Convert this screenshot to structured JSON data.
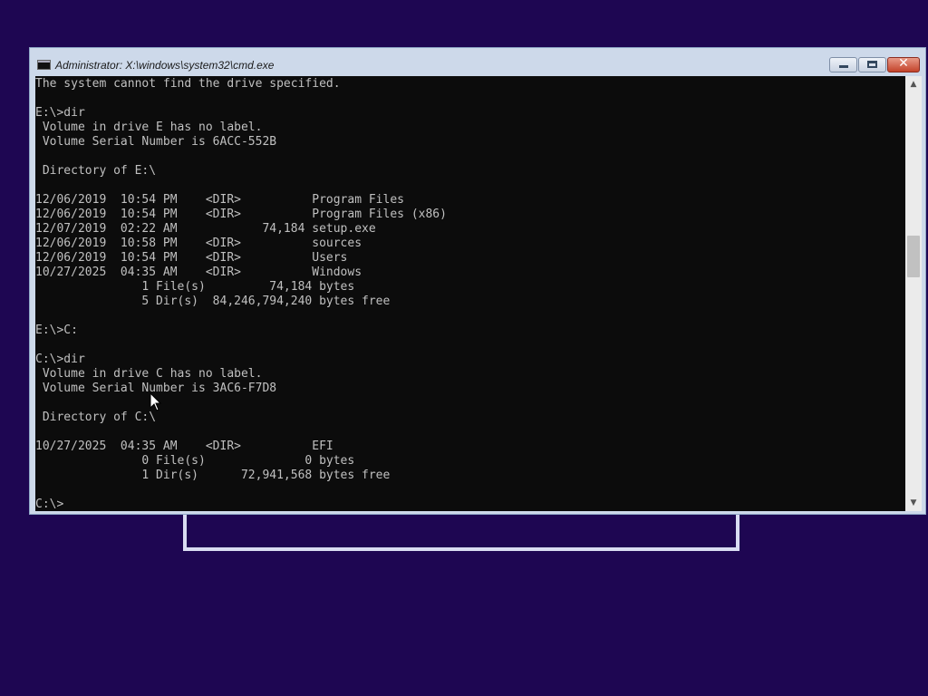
{
  "window": {
    "title": "Administrator: X:\\windows\\system32\\cmd.exe",
    "icon": "console-icon",
    "controls": {
      "minimize": "minimize-icon",
      "maximize": "maximize-icon",
      "close": "close-icon",
      "close_glyph": "✕"
    }
  },
  "console": {
    "foreground": "#c0c0c0",
    "background": "#0c0c0c",
    "lines": [
      "The system cannot find the drive specified.",
      "",
      "E:\\>dir",
      " Volume in drive E has no label.",
      " Volume Serial Number is 6ACC-552B",
      "",
      " Directory of E:\\",
      "",
      "12/06/2019  10:54 PM    <DIR>          Program Files",
      "12/06/2019  10:54 PM    <DIR>          Program Files (x86)",
      "12/07/2019  02:22 AM            74,184 setup.exe",
      "12/06/2019  10:58 PM    <DIR>          sources",
      "12/06/2019  10:54 PM    <DIR>          Users",
      "10/27/2025  04:35 AM    <DIR>          Windows",
      "               1 File(s)         74,184 bytes",
      "               5 Dir(s)  84,246,794,240 bytes free",
      "",
      "E:\\>C:",
      "",
      "C:\\>dir",
      " Volume in drive C has no label.",
      " Volume Serial Number is 3AC6-F7D8",
      "",
      " Directory of C:\\",
      "",
      "10/27/2025  04:35 AM    <DIR>          EFI",
      "               0 File(s)              0 bytes",
      "               1 Dir(s)      72,941,568 bytes free",
      "",
      "C:\\>"
    ]
  },
  "scrollbar": {
    "up_glyph": "▲",
    "down_glyph": "▼"
  },
  "colors": {
    "desktop": "#1e0652",
    "window_frame": "#cdd9ea",
    "close_button": "#c3432a"
  }
}
